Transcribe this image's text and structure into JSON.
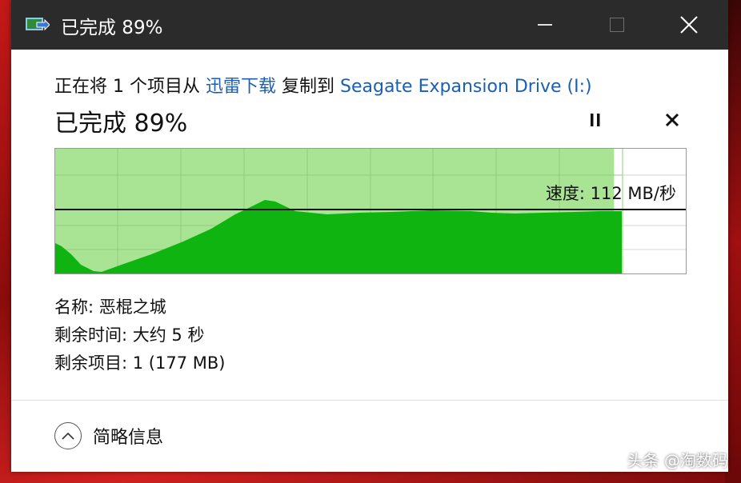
{
  "window": {
    "title": "已完成 89%",
    "title_bar_color": "#2b2b2b"
  },
  "copy": {
    "prefix": "正在将 1 个项目从 ",
    "source": "迅雷下载",
    "middle": " 复制到 ",
    "destination": "Seagate Expansion Drive (I:)",
    "link_color": "#1a5fb4"
  },
  "progress": {
    "title": "已完成 89%",
    "percent": 89,
    "speed_label": "速度: 112 MB/秒",
    "fill_color_light": "#a8e494",
    "fill_color_dark": "#10b410"
  },
  "details": {
    "name_line": "名称: 恶棍之城",
    "time_remaining_line": "剩余时间: 大约 5 秒",
    "items_remaining_line": "剩余项目: 1 (177 MB)"
  },
  "footer": {
    "less_details_label": "简略信息"
  },
  "watermark": "头条 @淘数码",
  "icons": [
    "copy-app-icon",
    "minimize-icon",
    "maximize-icon",
    "close-icon",
    "pause-icon",
    "cancel-icon",
    "chevron-up-icon"
  ]
}
